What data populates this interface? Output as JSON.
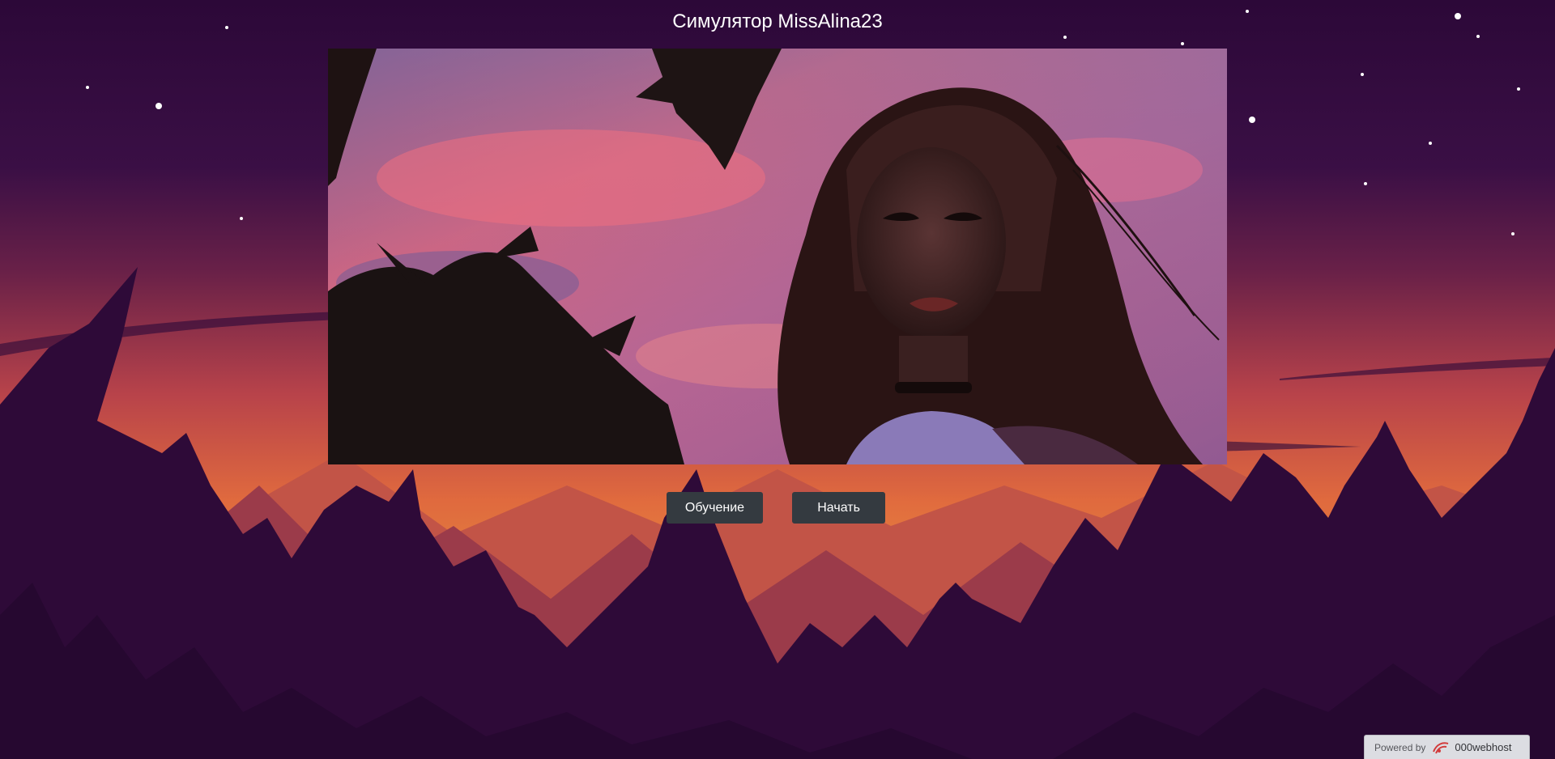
{
  "page": {
    "title": "Симулятор MissAlina23"
  },
  "hero": {
    "image_description": "painted portrait of a girl at sunset with palm silhouettes"
  },
  "buttons": {
    "learn_label": "Обучение",
    "start_label": "Начать"
  },
  "footer": {
    "powered_label": "Powered by",
    "brand_label": "000webhost"
  },
  "colors": {
    "night_sky": "#2a0a3a",
    "sunset_orange": "#e0673c",
    "mountain_dark": "#2e0a38",
    "button_bg": "#343a40",
    "badge_bg": "#dcdde2"
  }
}
